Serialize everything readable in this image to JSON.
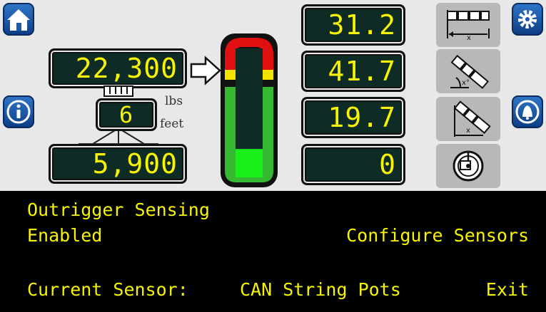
{
  "readouts": {
    "load": "22,300",
    "load_unit": "lbs",
    "boom_length": "6",
    "length_unit": "feet",
    "capacity": "5,900"
  },
  "right_readouts": [
    "31.2",
    "41.7",
    "19.7",
    "0"
  ],
  "gauge": {
    "fill_fraction": 0.22
  },
  "icons": {
    "home": "home-icon",
    "info": "info-icon",
    "settings": "gear-icon",
    "alarm": "bell-icon",
    "length_mode": "length-icon",
    "angle_mode": "angle-icon",
    "radius_mode": "radius-icon",
    "slew_mode": "slew-icon"
  },
  "menu": {
    "title_line1": "Outrigger Sensing",
    "title_line2": "Enabled",
    "configure": "Configure Sensors",
    "current_label": "Current Sensor:",
    "current_value": "CAN String Pots",
    "exit": "Exit"
  },
  "colors": {
    "readout_text": "#f6f400",
    "readout_bg": "#0f2b25",
    "gauge_red": "#e01010",
    "gauge_yellow": "#f2e400",
    "gauge_green": "#36b833",
    "gauge_fill": "#19f019",
    "button_blue": "#1f5fb5"
  }
}
